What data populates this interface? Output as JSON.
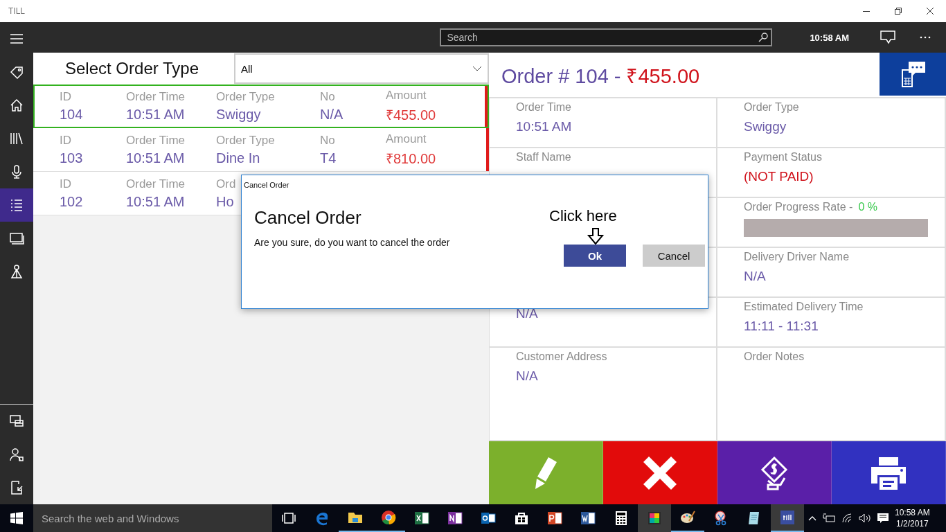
{
  "window": {
    "title": "TILL"
  },
  "sidebar": {
    "top": [
      {
        "kind": "menu",
        "selected": false
      },
      {
        "kind": "tag",
        "selected": false
      },
      {
        "kind": "home",
        "selected": false
      },
      {
        "kind": "library",
        "selected": false
      },
      {
        "kind": "mic",
        "selected": false
      },
      {
        "kind": "list",
        "selected": true
      },
      {
        "kind": "screen",
        "selected": false
      },
      {
        "kind": "pin",
        "selected": false
      }
    ],
    "bottom": [
      {
        "kind": "devices",
        "selected": false
      },
      {
        "kind": "person",
        "selected": false
      },
      {
        "kind": "exit",
        "selected": false
      }
    ]
  },
  "top_bar": {
    "search": {
      "placeholder": "Search"
    },
    "time": "10:58 AM"
  },
  "order_list": {
    "filter_label": "Select Order Type",
    "filter_value": "All",
    "rows": [
      {
        "selected": true,
        "color": "#e01b1b",
        "cells": [
          {
            "header": "ID",
            "value": "104"
          },
          {
            "header": "Order Time",
            "value": "10:51 AM"
          },
          {
            "header": "Order Type",
            "value": "Swiggy"
          },
          {
            "header": "No",
            "value": "N/A"
          },
          {
            "header": "Amount",
            "value": "₹455.00",
            "kind": "amount"
          }
        ]
      },
      {
        "selected": false,
        "color": "#e01b1b",
        "cells": [
          {
            "header": "ID",
            "value": "103"
          },
          {
            "header": "Order Time",
            "value": "10:51 AM"
          },
          {
            "header": "Order Type",
            "value": "Dine In"
          },
          {
            "header": "No",
            "value": "T4"
          },
          {
            "header": "Amount",
            "value": "₹810.00",
            "kind": "amount"
          }
        ]
      },
      {
        "selected": false,
        "cells": [
          {
            "header": "ID",
            "value": "102"
          },
          {
            "header": "Order Time",
            "value": "10:51 AM"
          },
          {
            "header": "Ord",
            "value": "Ho"
          }
        ]
      }
    ]
  },
  "order_detail": {
    "title": "Order # 104 -",
    "amount": "₹455.00",
    "rows": [
      {
        "cells": [
          {
            "kind": "text",
            "label": "Order Time",
            "value": "10:51 AM"
          },
          {
            "kind": "text",
            "label": "Order Type",
            "value": "Swiggy"
          }
        ]
      },
      {
        "cells": [
          {
            "kind": "text",
            "label": "Staff Name"
          },
          {
            "kind": "status",
            "label": "Payment Status",
            "value": "(NOT PAID)"
          }
        ]
      },
      {
        "cells": [
          {
            "kind": "blank"
          },
          {
            "kind": "progress",
            "label": "Order Progress Rate -",
            "reading": "0 %",
            "level": 0
          }
        ]
      },
      {
        "cells": [
          {
            "kind": "blank"
          },
          {
            "kind": "text",
            "label": "Delivery Driver Name",
            "value": "N/A"
          }
        ]
      },
      {
        "cells": [
          {
            "kind": "text",
            "value": "N/A"
          },
          {
            "kind": "text",
            "label": "Estimated Delivery Time",
            "value": "11:11  -  11:31"
          }
        ]
      },
      {
        "cells": [
          {
            "kind": "text",
            "label": "Customer Address",
            "value": "N/A"
          },
          {
            "kind": "text",
            "label": "Order Notes"
          }
        ]
      }
    ],
    "actions": [
      {
        "kind": "edit",
        "color": "#7cb02c"
      },
      {
        "kind": "cancel",
        "color": "#e20b0b"
      },
      {
        "kind": "payment",
        "color": "#5a1fa8"
      },
      {
        "kind": "print",
        "color": "#3131c0"
      }
    ]
  },
  "dialog": {
    "window_title": "Cancel Order",
    "heading": "Cancel Order",
    "message": "Are you sure, do you want to cancel the order",
    "buttons": [
      {
        "label": "Ok",
        "kind": "primary"
      },
      {
        "label": "Cancel",
        "kind": "secondary"
      }
    ],
    "callout": "Click here"
  },
  "taskbar": {
    "search_placeholder": "Search the web and Windows",
    "apps": [
      {
        "kind": "taskview",
        "running": false,
        "selected": false
      },
      {
        "kind": "edge",
        "running": false,
        "selected": false
      },
      {
        "kind": "folder",
        "running": true,
        "selected": false
      },
      {
        "kind": "chrome",
        "running": true,
        "selected": false
      },
      {
        "kind": "excel",
        "running": false,
        "selected": false
      },
      {
        "kind": "onenote",
        "running": false,
        "selected": false
      },
      {
        "kind": "outlook",
        "running": false,
        "selected": false
      },
      {
        "kind": "store",
        "running": false,
        "selected": false
      },
      {
        "kind": "powerpoint",
        "running": false,
        "selected": false
      },
      {
        "kind": "word",
        "running": false,
        "selected": false
      },
      {
        "kind": "calculator",
        "running": false,
        "selected": false
      },
      {
        "kind": "tiles",
        "running": false,
        "selected": true
      },
      {
        "kind": "paint",
        "running": true,
        "selected": false
      },
      {
        "kind": "snip",
        "running": false,
        "selected": false
      },
      {
        "kind": "notepad",
        "running": false,
        "selected": false
      },
      {
        "kind": "till",
        "running": true,
        "selected": true
      }
    ],
    "time": "10:58 AM",
    "date": "1/2/2017"
  }
}
